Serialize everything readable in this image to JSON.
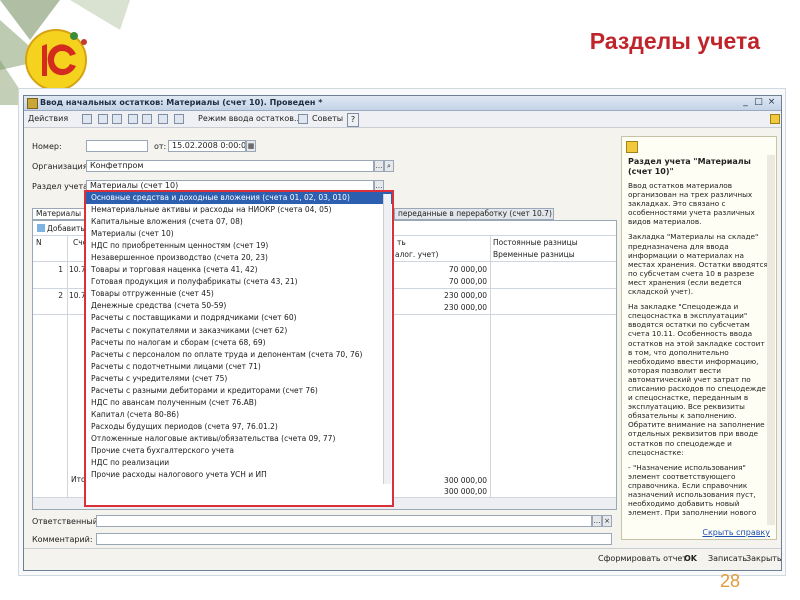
{
  "slide": {
    "title": "Разделы учета",
    "page_number": "28"
  },
  "window": {
    "title": "Ввод начальных остатков: Материалы (счет 10). Проведен *"
  },
  "toolbar": {
    "actions": "Действия",
    "mode": "Режим ввода остатков...",
    "tips": "Советы",
    "help": "?"
  },
  "form": {
    "number_label": "Номер:",
    "number_value": "",
    "date_label": "от:",
    "date_value": "15.02.2008 0:00:00",
    "org_label": "Организация:",
    "org_value": "Конфетпром",
    "section_label": "Раздел учета:",
    "section_value": "Материалы (счет 10)",
    "responsible_label": "Ответственный:",
    "responsible_value": "",
    "comment_label": "Комментарий:",
    "comment_value": ""
  },
  "tabs": {
    "first": "Материалы на",
    "last": "переданные в переработку (счет 10.7)"
  },
  "grid": {
    "add_button": "Добавить",
    "col_n": "N",
    "col_account": "Счет",
    "col_sum": "ть",
    "col_sum2": "алог. учет)",
    "col_const": "Постоянные разницы",
    "col_temp": "Временные разницы",
    "rows": [
      {
        "n": "1",
        "acc": "10.7",
        "v1": "70 000,00",
        "v2": "70 000,00"
      },
      {
        "n": "2",
        "acc": "10.7",
        "v1": "230 000,00",
        "v2": "230 000,00"
      }
    ],
    "total_label": "Итог",
    "total_1": "300 000,00",
    "total_2": "300 000,00"
  },
  "dropdown": {
    "items": [
      "Основные средства и доходные вложения (счета 01, 02, 03, 010)",
      "Нематериальные активы и расходы на НИОКР (счета 04, 05)",
      "Капитальные вложения (счета 07, 08)",
      "Материалы (счет 10)",
      "НДС по приобретенным ценностям (счет 19)",
      "Незавершенное производство (счета 20, 23)",
      "Товары и торговая наценка (счета 41, 42)",
      "Готовая продукция и полуфабрикаты (счета 43, 21)",
      "Товары отгруженные (счет 45)",
      "Денежные средства (счета 50-59)",
      "Расчеты с поставщиками и подрядчиками (счет 60)",
      "Расчеты с покупателями и заказчиками (счет 62)",
      "Расчеты по налогам и сборам (счета 68, 69)",
      "Расчеты с персоналом по оплате труда и депонентам (счета 70, 76)",
      "Расчеты с подотчетными лицами (счет 71)",
      "Расчеты с учредителями (счет 75)",
      "Расчеты с разными дебиторами и кредиторами (счет 76)",
      "НДС по авансам полученным (счет 76.АВ)",
      "Капитал (счета 80-86)",
      "Расходы будущих периодов (счета 97, 76.01.2)",
      "Отложенные налоговые активы/обязательства (счета 09, 77)",
      "Прочие счета бухгалтерского учета",
      "НДС по реализации",
      "Прочие расходы налогового учета УСН и ИП"
    ]
  },
  "help": {
    "title": "Раздел учета \"Материалы (счет 10)\"",
    "p1": "Ввод остатков материалов организован на трех различных закладках. Это связано с особенностями учета различных видов материалов.",
    "p2": "Закладка \"Материалы на складе\" предназначена для ввода информации о материалах на местах хранения. Остатки вводятся по субсчетам счета 10 в разрезе мест хранения (если ведется складской учет).",
    "p3": "На закладке \"Спецодежда и спецоснастка в эксплуатации\" вводятся остатки по субсчетам счета 10.11. Особенность ввода остатков на этой закладке состоит в том, что дополнительно необходимо ввести информацию, которая позволит вести автоматический учет затрат по списанию расходов по спецодежде и спецоснастке, переданным в эксплуатацию. Все реквизиты обязательны к заполнению. Обратите внимание на заполнение отдельных реквизитов при вводе остатков по спецодежде и спецоснастке:",
    "p4": "- \"Назначение использования\" элемент соответствующего справочника. Если справочник назначений использования пуст, необходимо добавить новый элемент. При заполнении нового",
    "link": "Скрыть справку"
  },
  "footer": {
    "form": "Сформировать отчет",
    "ok": "OK",
    "save": "Записать",
    "close": "Закрыть"
  },
  "colors": {
    "title": "#c0242b",
    "highlight": "#d9303a",
    "selection": "#2d5fb0"
  }
}
